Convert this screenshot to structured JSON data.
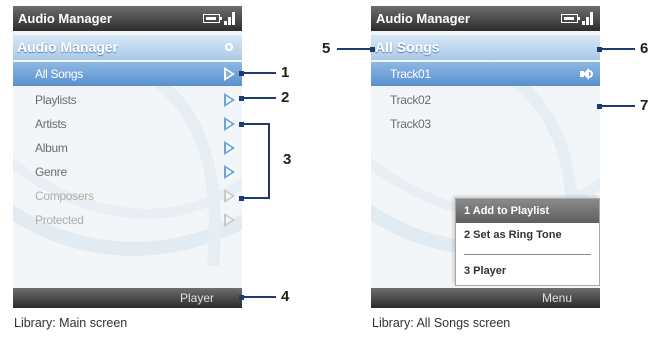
{
  "main_screen": {
    "title": "Audio Manager",
    "header": "Audio Manager",
    "items": [
      {
        "label": "All Songs"
      },
      {
        "label": "Playlists"
      },
      {
        "label": "Artists"
      },
      {
        "label": "Album"
      },
      {
        "label": "Genre"
      },
      {
        "label": "Composers"
      },
      {
        "label": "Protected"
      }
    ],
    "softkey_right": "Player",
    "caption": "Library: Main screen"
  },
  "songs_screen": {
    "title": "Audio Manager",
    "header": "All Songs",
    "tracks": [
      {
        "label": "Track01"
      },
      {
        "label": "Track02"
      },
      {
        "label": "Track03"
      }
    ],
    "menu": [
      {
        "label": "1 Add to Playlist"
      },
      {
        "label": "2 Set as Ring Tone"
      },
      {
        "label": "3 Player"
      }
    ],
    "softkey_right": "Menu",
    "caption": "Library: All Songs screen"
  },
  "callouts": [
    "1",
    "2",
    "3",
    "4",
    "5",
    "6",
    "7"
  ],
  "colors": {
    "selection": "#5a90cf",
    "header": "#a9c9e8",
    "titlebar": "#2c2c2c",
    "callout": "#1d3d6e"
  },
  "icons": [
    "battery-icon",
    "signal-icon",
    "search-icon",
    "arrow-right-icon",
    "speaker-icon"
  ]
}
